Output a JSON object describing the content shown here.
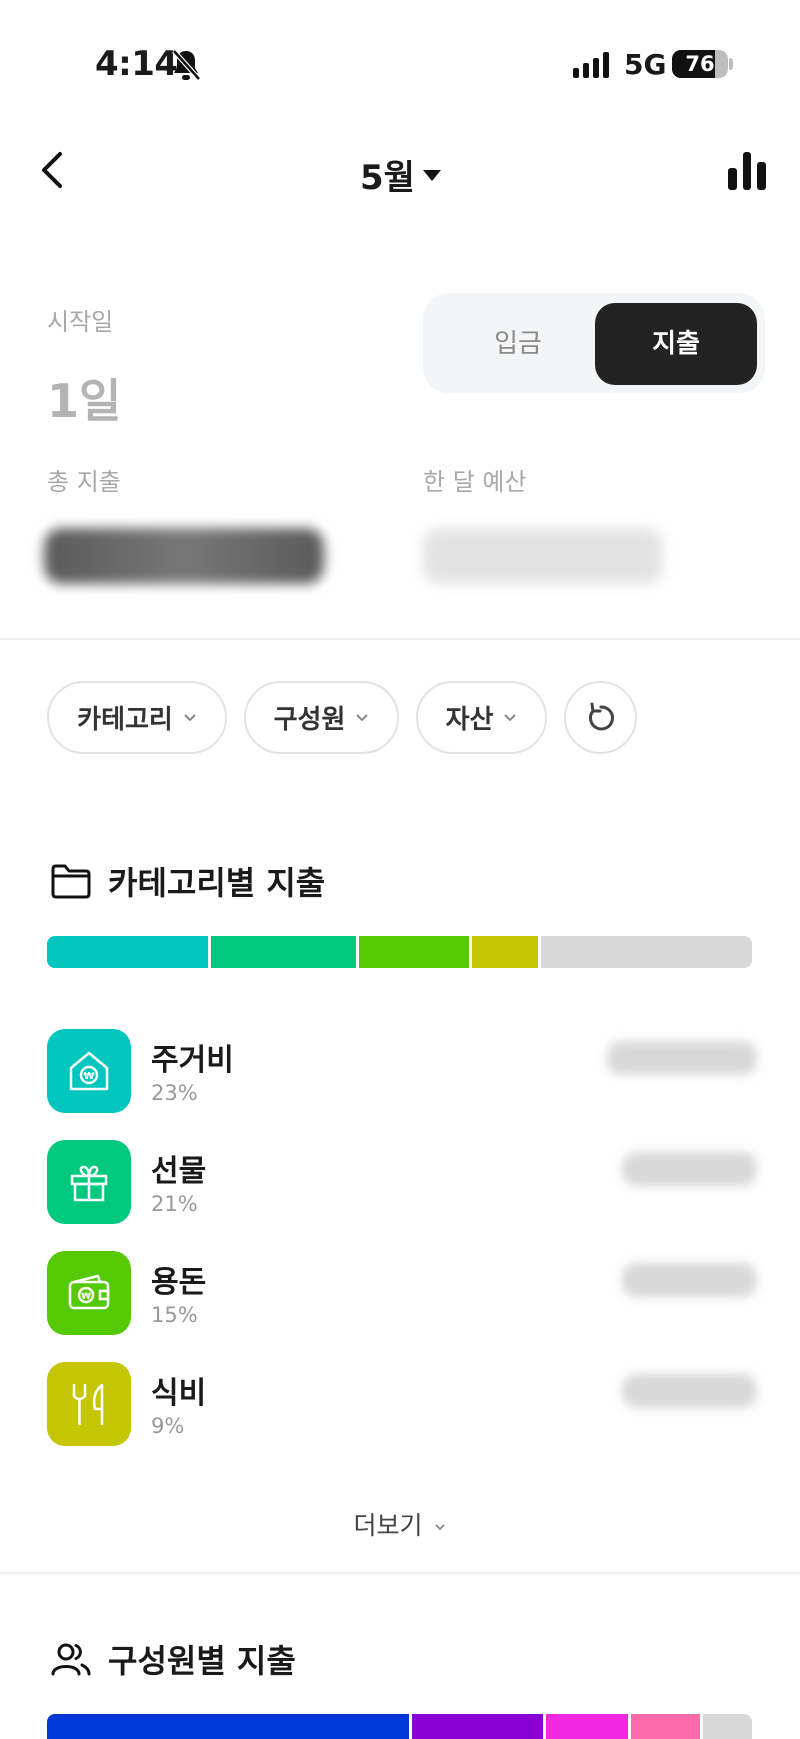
{
  "status_bar": {
    "time": "4:14",
    "network": "5G",
    "battery_level": "76",
    "battery_fraction": 0.76
  },
  "header": {
    "month": "5월"
  },
  "summary": {
    "start_label": "시작일",
    "start_day": "1일",
    "total_expense_label": "총 지출",
    "monthly_budget_label": "한 달 예산",
    "toggle": {
      "income": "입금",
      "expense": "지출",
      "selected": "expense"
    }
  },
  "filters": {
    "category": "카테고리",
    "member": "구성원",
    "asset": "자산"
  },
  "category_section": {
    "title": "카테고리별 지출",
    "bar_colors": [
      "#00c6bf",
      "#00c97d",
      "#55c903",
      "#c3c600",
      "#d8d8d8"
    ],
    "items": [
      {
        "name": "주거비",
        "percent": "23%",
        "color": "#00c6bf",
        "icon": "house-won-icon"
      },
      {
        "name": "선물",
        "percent": "21%",
        "color": "#00c97d",
        "icon": "gift-icon"
      },
      {
        "name": "용돈",
        "percent": "15%",
        "color": "#55c903",
        "icon": "wallet-won-icon"
      },
      {
        "name": "식비",
        "percent": "9%",
        "color": "#c3c600",
        "icon": "fork-knife-icon"
      }
    ],
    "more_label": "더보기"
  },
  "member_section": {
    "title": "구성원별 지출",
    "bar_colors": [
      "#0037d6",
      "#8a00d4",
      "#f028e0",
      "#ff6aa8",
      "#d8d8d8"
    ]
  }
}
